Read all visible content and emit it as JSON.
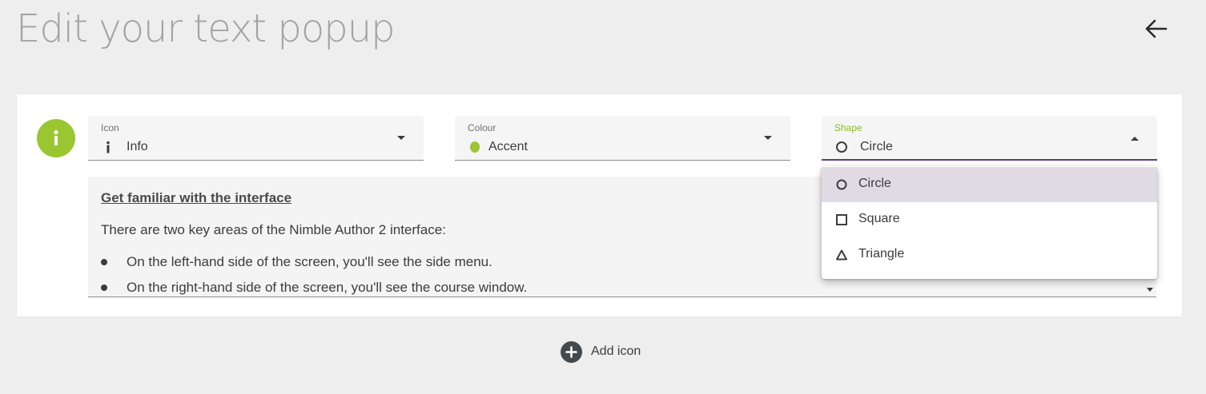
{
  "header": {
    "title": "Edit your text popup",
    "back_icon": "arrow-left-icon"
  },
  "badge": {
    "icon": "info-icon",
    "glyph": "i",
    "color": "#9ac632"
  },
  "fields": {
    "icon": {
      "label": "Icon",
      "value": "Info",
      "icon": "info-icon"
    },
    "colour": {
      "label": "Colour",
      "value": "Accent",
      "swatch_color": "#9ac632"
    },
    "shape": {
      "label": "Shape",
      "value": "Circle",
      "icon": "circle-icon",
      "state": "open"
    }
  },
  "content": {
    "heading": "Get familiar with the interface",
    "intro": "There are two key areas of the Nimble Author 2 interface:",
    "bullets": [
      "On the left-hand side of the screen, you'll see the side menu.",
      "On the right-hand side of the screen, you'll see the course window."
    ]
  },
  "shape_options": [
    {
      "label": "Circle",
      "icon": "circle-icon",
      "selected": true
    },
    {
      "label": "Square",
      "icon": "square-icon",
      "selected": false
    },
    {
      "label": "Triangle",
      "icon": "triangle-icon",
      "selected": false
    }
  ],
  "add_icon": {
    "label": "Add icon",
    "icon": "plus-circle-icon"
  },
  "colors": {
    "accent": "#9ac632",
    "focus": "#5b3e7d",
    "selected_row": "#e0dae5"
  }
}
